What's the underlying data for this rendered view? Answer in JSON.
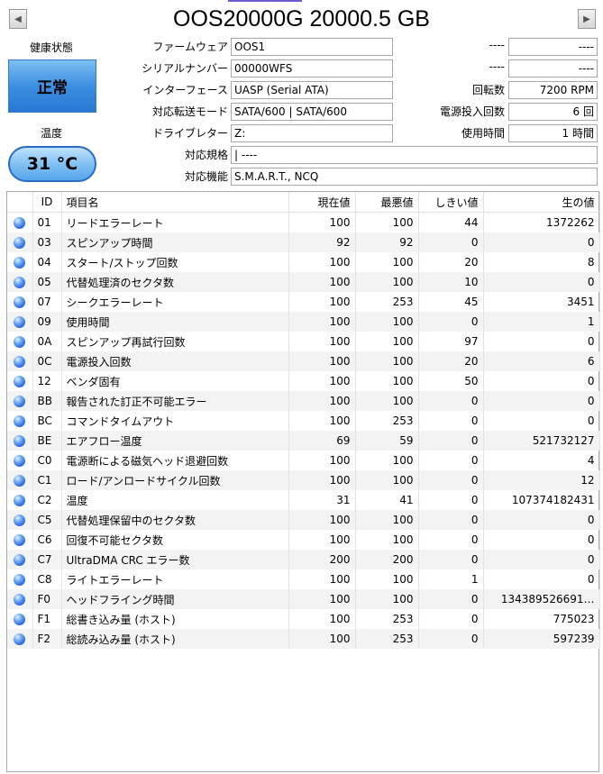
{
  "nav": {
    "prev_icon": "◀",
    "next_icon": "▶"
  },
  "title": "OOS20000G 20000.5 GB",
  "health": {
    "label": "健康状態",
    "value": "正常",
    "color": "#3c8fe0"
  },
  "temperature": {
    "label": "温度",
    "value": "31 °C"
  },
  "info": {
    "firmware": {
      "label": "ファームウェア",
      "value": "OOS1"
    },
    "serial": {
      "label": "シリアルナンバー",
      "value": "00000WFS"
    },
    "interface": {
      "label": "インターフェース",
      "value": "UASP (Serial ATA)"
    },
    "transfer_mode": {
      "label": "対応転送モード",
      "value": "SATA/600 | SATA/600"
    },
    "drive_letter": {
      "label": "ドライブレター",
      "value": "Z:"
    },
    "standard": {
      "label": "対応規格",
      "value": "| ----"
    },
    "features": {
      "label": "対応機能",
      "value": "S.M.A.R.T., NCQ"
    }
  },
  "right_info": {
    "blank1": {
      "label": "----",
      "value": "----"
    },
    "blank2": {
      "label": "----",
      "value": "----"
    },
    "rotation": {
      "label": "回転数",
      "value": "7200 RPM"
    },
    "power_count": {
      "label": "電源投入回数",
      "value": "6 回"
    },
    "power_hours": {
      "label": "使用時間",
      "value": "1 時間"
    }
  },
  "smart": {
    "headers": [
      "ID",
      "項目名",
      "現在値",
      "最悪値",
      "しきい値",
      "生の値"
    ],
    "status_icon": "status-good-icon",
    "rows": [
      {
        "id": "01",
        "name": "リードエラーレート",
        "current": "100",
        "worst": "100",
        "threshold": "44",
        "raw": "1372262"
      },
      {
        "id": "03",
        "name": "スピンアップ時間",
        "current": "92",
        "worst": "92",
        "threshold": "0",
        "raw": "0"
      },
      {
        "id": "04",
        "name": "スタート/ストップ回数",
        "current": "100",
        "worst": "100",
        "threshold": "20",
        "raw": "8"
      },
      {
        "id": "05",
        "name": "代替処理済のセクタ数",
        "current": "100",
        "worst": "100",
        "threshold": "10",
        "raw": "0"
      },
      {
        "id": "07",
        "name": "シークエラーレート",
        "current": "100",
        "worst": "253",
        "threshold": "45",
        "raw": "3451"
      },
      {
        "id": "09",
        "name": "使用時間",
        "current": "100",
        "worst": "100",
        "threshold": "0",
        "raw": "1"
      },
      {
        "id": "0A",
        "name": "スピンアップ再試行回数",
        "current": "100",
        "worst": "100",
        "threshold": "97",
        "raw": "0"
      },
      {
        "id": "0C",
        "name": "電源投入回数",
        "current": "100",
        "worst": "100",
        "threshold": "20",
        "raw": "6"
      },
      {
        "id": "12",
        "name": "ベンダ固有",
        "current": "100",
        "worst": "100",
        "threshold": "50",
        "raw": "0"
      },
      {
        "id": "BB",
        "name": "報告された訂正不可能エラー",
        "current": "100",
        "worst": "100",
        "threshold": "0",
        "raw": "0"
      },
      {
        "id": "BC",
        "name": "コマンドタイムアウト",
        "current": "100",
        "worst": "253",
        "threshold": "0",
        "raw": "0"
      },
      {
        "id": "BE",
        "name": "エアフロー温度",
        "current": "69",
        "worst": "59",
        "threshold": "0",
        "raw": "521732127"
      },
      {
        "id": "C0",
        "name": "電源断による磁気ヘッド退避回数",
        "current": "100",
        "worst": "100",
        "threshold": "0",
        "raw": "4"
      },
      {
        "id": "C1",
        "name": "ロード/アンロードサイクル回数",
        "current": "100",
        "worst": "100",
        "threshold": "0",
        "raw": "12"
      },
      {
        "id": "C2",
        "name": "温度",
        "current": "31",
        "worst": "41",
        "threshold": "0",
        "raw": "107374182431"
      },
      {
        "id": "C5",
        "name": "代替処理保留中のセクタ数",
        "current": "100",
        "worst": "100",
        "threshold": "0",
        "raw": "0"
      },
      {
        "id": "C6",
        "name": "回復不可能セクタ数",
        "current": "100",
        "worst": "100",
        "threshold": "0",
        "raw": "0"
      },
      {
        "id": "C7",
        "name": "UltraDMA CRC エラー数",
        "current": "200",
        "worst": "200",
        "threshold": "0",
        "raw": "0"
      },
      {
        "id": "C8",
        "name": "ライトエラーレート",
        "current": "100",
        "worst": "100",
        "threshold": "1",
        "raw": "0"
      },
      {
        "id": "F0",
        "name": "ヘッドフライング時間",
        "current": "100",
        "worst": "100",
        "threshold": "0",
        "raw": "134389526691…"
      },
      {
        "id": "F1",
        "name": "総書き込み量 (ホスト)",
        "current": "100",
        "worst": "253",
        "threshold": "0",
        "raw": "775023"
      },
      {
        "id": "F2",
        "name": "総読み込み量 (ホスト)",
        "current": "100",
        "worst": "253",
        "threshold": "0",
        "raw": "597239"
      }
    ]
  }
}
